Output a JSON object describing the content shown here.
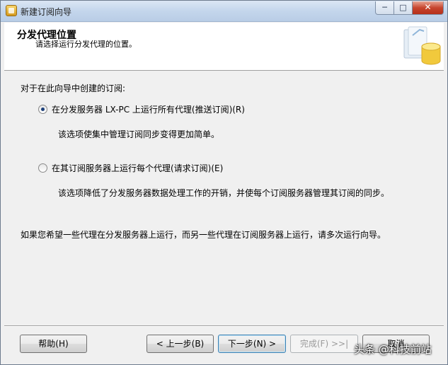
{
  "window": {
    "title": "新建订阅向导",
    "minimize_glyph": "─",
    "maximize_glyph": "□",
    "close_glyph": "✕"
  },
  "header": {
    "title": "分发代理位置",
    "subtitle": "请选择运行分发代理的位置。"
  },
  "content": {
    "prompt": "对于在此向导中创建的订阅:",
    "options": [
      {
        "label": "在分发服务器 LX-PC 上运行所有代理(推送订阅)(R)",
        "selected": true,
        "description": "该选项使集中管理订阅同步变得更加简单。"
      },
      {
        "label": "在其订阅服务器上运行每个代理(请求订阅)(E)",
        "selected": false,
        "description": "该选项降低了分发服务器数据处理工作的开销，并使每个订阅服务器管理其订阅的同步。"
      }
    ],
    "footer_note": "如果您希望一些代理在分发服务器上运行，而另一些代理在订阅服务器上运行，请多次运行向导。"
  },
  "buttons": {
    "help": "帮助(H)",
    "back": "< 上一步(B)",
    "next": "下一步(N) >",
    "finish": "完成(F) >>|",
    "cancel": "取消"
  },
  "watermark": "头条 @科技前站",
  "colors": {
    "title_bar": "#c4d6ec",
    "dialog_bg": "#f0f0f0",
    "close_button": "#c7452e",
    "radio_dot": "#1c3f7a"
  }
}
